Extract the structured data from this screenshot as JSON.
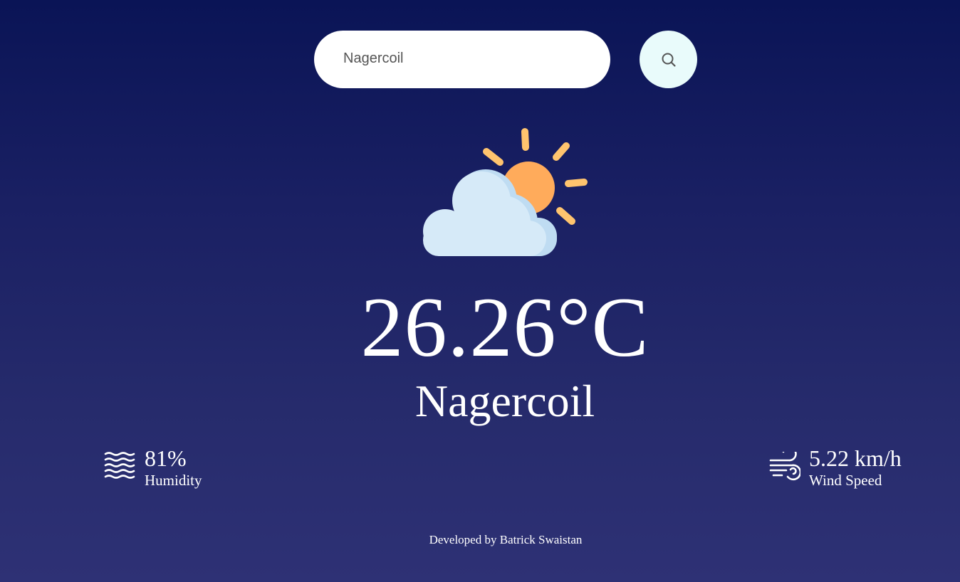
{
  "search": {
    "value": "Nagercoil",
    "icon": "search-icon"
  },
  "weather": {
    "icon": "partly-cloudy-icon",
    "temperature": "26.26°C",
    "city": "Nagercoil"
  },
  "humidity": {
    "icon": "humidity-waves-icon",
    "value": "81%",
    "label": "Humidity"
  },
  "wind": {
    "icon": "wind-icon",
    "value": "5.22 km/h",
    "label": "Wind Speed"
  },
  "footer": {
    "credit": "Developed by Batrick Swaistan"
  },
  "colors": {
    "background_top": "#0a1456",
    "background_bottom": "#2e3175",
    "search_button_bg": "#e9fbfb",
    "sun": "#ffab5b",
    "sun_rays": "#ffc46e",
    "cloud": "#d6eaf8"
  }
}
